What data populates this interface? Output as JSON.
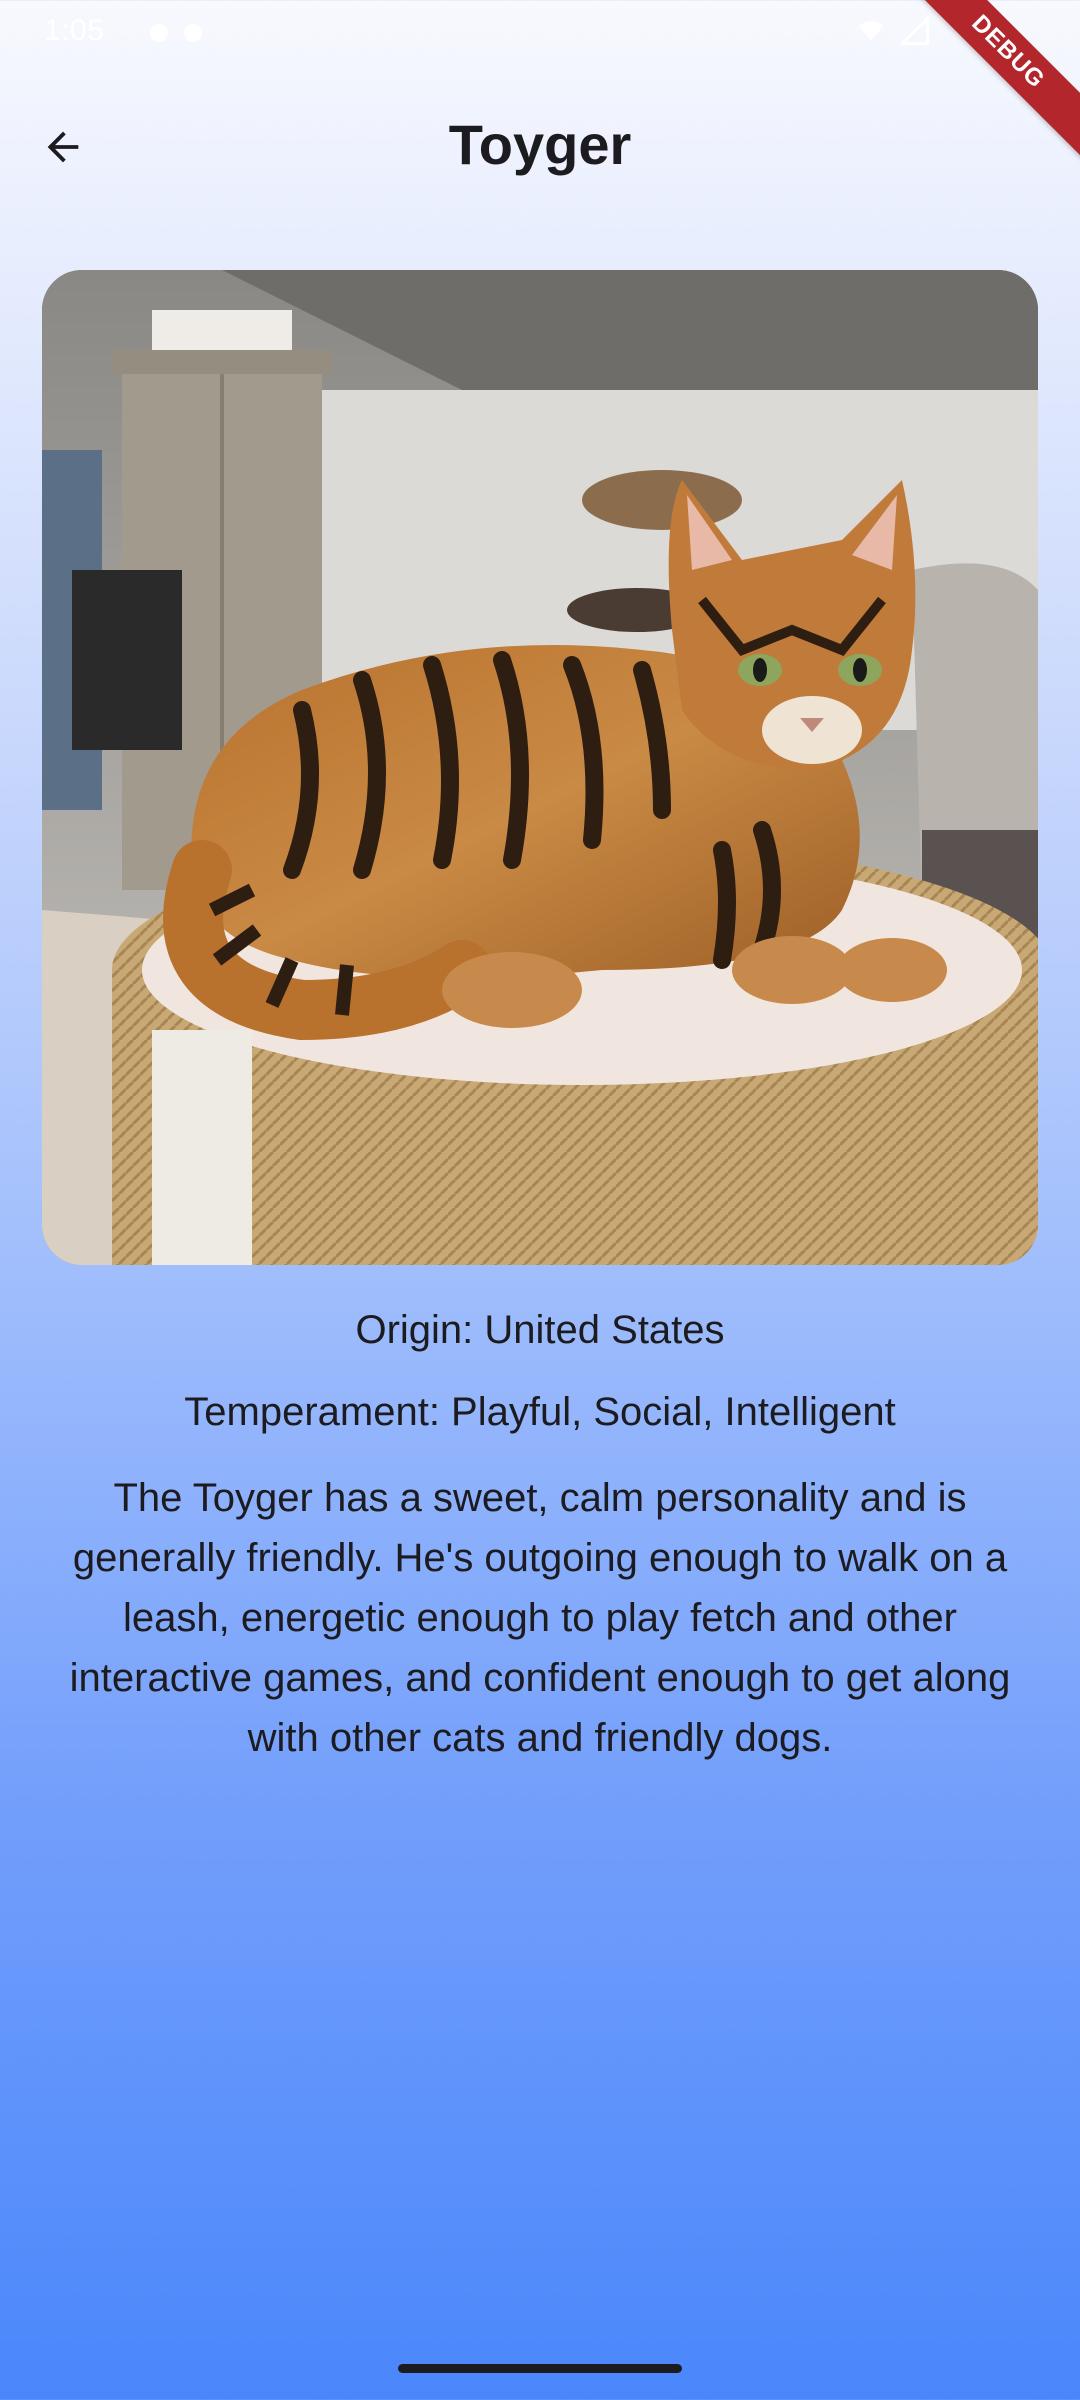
{
  "status_bar": {
    "time": "1:05"
  },
  "debug_banner": "DEBUG",
  "app_bar": {
    "title": "Toyger"
  },
  "breed": {
    "origin": "Origin: United States",
    "temperament": "Temperament: Playful, Social, Intelligent",
    "description": "The Toyger has a sweet, calm personality and is generally friendly. He's outgoing enough to walk on a leash, energetic enough to play fetch and other interactive games, and confident enough to get along with other cats and friendly dogs."
  },
  "colors": {
    "gradient_top": "#f8f9fe",
    "gradient_bottom": "#4a87fb",
    "debug": "#b3262c"
  },
  "icons": {
    "back": "arrow-back-icon"
  }
}
